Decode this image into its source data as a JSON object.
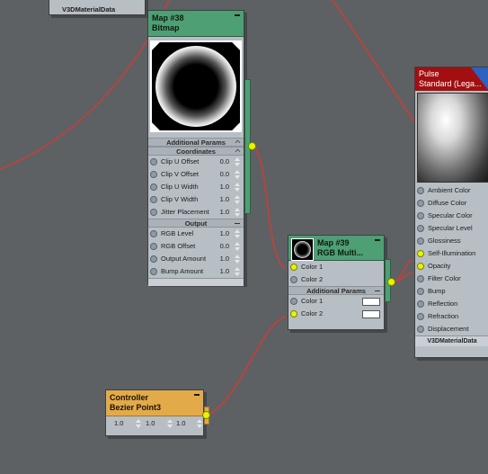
{
  "nodes": {
    "v3d_top": {
      "label": "V3DMaterialData"
    },
    "bitmap": {
      "title": "Map #38",
      "subtitle": "Bitmap",
      "sections": {
        "additional_params": "Additional Params",
        "coordinates": "Coordinates",
        "output": "Output"
      },
      "coordinate_params": [
        {
          "label": "Clip U Offset",
          "value": "0.0"
        },
        {
          "label": "Clip V Offset",
          "value": "0.0"
        },
        {
          "label": "Clip U Width",
          "value": "1.0"
        },
        {
          "label": "Clip V Width",
          "value": "1.0"
        },
        {
          "label": "Jitter Placement",
          "value": "1.0"
        }
      ],
      "output_params": [
        {
          "label": "RGB Level",
          "value": "1.0"
        },
        {
          "label": "RGB Offset",
          "value": "0.0"
        },
        {
          "label": "Output Amount",
          "value": "1.0"
        },
        {
          "label": "Bump Amount",
          "value": "1.0"
        }
      ]
    },
    "rgb_multiply": {
      "title": "Map #39",
      "subtitle": "RGB Multi...",
      "inputs": [
        "Color 1",
        "Color 2"
      ],
      "section": "Additional Params",
      "extra": [
        "Color 1",
        "Color 2"
      ]
    },
    "standard": {
      "title": "Pulse",
      "subtitle": "Standard (Lega...",
      "inputs": [
        "Ambient Color",
        "Diffuse Color",
        "Specular Color",
        "Specular Level",
        "Glossiness",
        "Self-Illumination",
        "Opacity",
        "Filter Color",
        "Bump",
        "Reflection",
        "Refraction",
        "Displacement"
      ],
      "footer": "V3DMaterialData"
    },
    "controller": {
      "title": "Controller",
      "subtitle": "Bezier Point3",
      "values": [
        "1.0",
        "1.0",
        "1.0"
      ]
    }
  },
  "colors": {
    "background": "#5e6164",
    "map_header": "#4e9f74",
    "controller_header": "#e3aa4a",
    "material_header": "#a30f10",
    "wire": "#e8332a",
    "active_socket": "#e6f500"
  }
}
